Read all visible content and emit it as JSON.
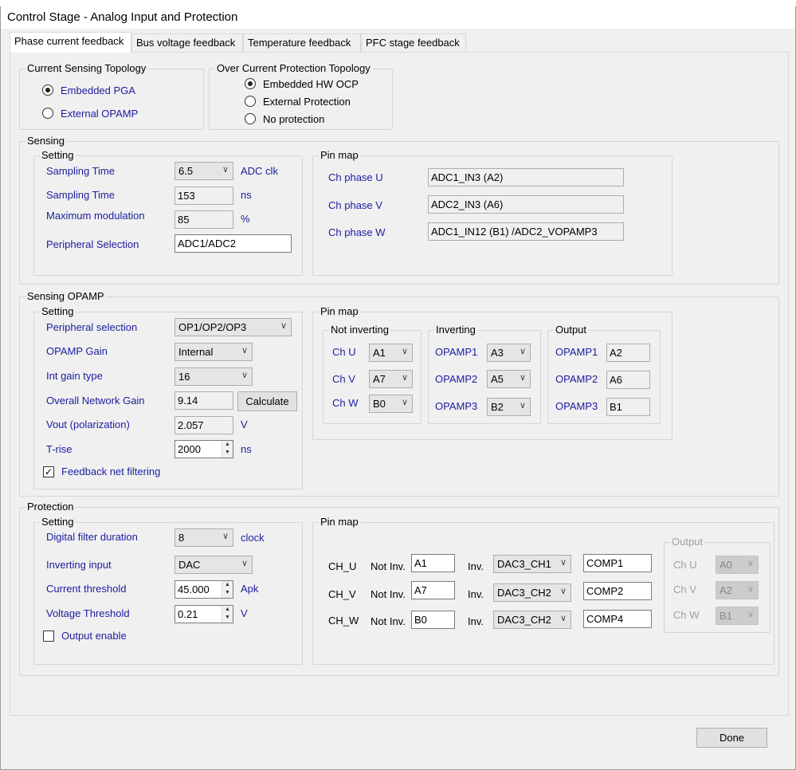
{
  "window": {
    "title": "Control Stage - Analog Input and Protection"
  },
  "tabs": [
    "Phase current feedback",
    "Bus voltage feedback",
    "Temperature feedback",
    "PFC stage feedback"
  ],
  "current_sensing": {
    "title": "Current Sensing Topology",
    "options": [
      "Embedded PGA",
      "External OPAMP"
    ],
    "selected": 0
  },
  "ocp": {
    "title": "Over Current Protection Topology",
    "options": [
      "Embedded HW OCP",
      "External Protection",
      "No protection"
    ],
    "selected": 0
  },
  "sensing": {
    "title": "Sensing",
    "setting_title": "Setting",
    "sampling_time_label": "Sampling Time",
    "sampling_time_value": "6.5",
    "sampling_time_unit": "ADC clk",
    "sampling_ns_label": "Sampling Time",
    "sampling_ns_value": "153",
    "sampling_ns_unit": "ns",
    "max_mod_label": "Maximum modulation",
    "max_mod_value": "85",
    "max_mod_unit": "%",
    "periph_label": "Peripheral Selection",
    "periph_value": "ADC1/ADC2",
    "pinmap_title": "Pin map",
    "pins": [
      {
        "label": "Ch phase U",
        "value": "ADC1_IN3 (A2)"
      },
      {
        "label": "Ch phase V",
        "value": "ADC2_IN3 (A6)"
      },
      {
        "label": "Ch phase W",
        "value": "ADC1_IN12 (B1) /ADC2_VOPAMP3"
      }
    ]
  },
  "opamp": {
    "title": "Sensing OPAMP",
    "setting_title": "Setting",
    "periph_label": "Peripheral selection",
    "periph_value": "OP1/OP2/OP3",
    "gain_label": "OPAMP Gain",
    "gain_value": "Internal",
    "int_gain_label": "Int gain type",
    "int_gain_value": "16",
    "net_gain_label": "Overall Network Gain",
    "net_gain_value": "9.14",
    "calculate": "Calculate",
    "vout_label": "Vout (polarization)",
    "vout_value": "2.057",
    "vout_unit": "V",
    "trise_label": "T-rise",
    "trise_value": "2000",
    "trise_unit": "ns",
    "filter_label": "Feedback net filtering",
    "filter_checked": true,
    "pinmap_title": "Pin map",
    "not_inv": {
      "title": "Not inverting",
      "rows": [
        {
          "label": "Ch U",
          "value": "A1"
        },
        {
          "label": "Ch V",
          "value": "A7"
        },
        {
          "label": "Ch W",
          "value": "B0"
        }
      ]
    },
    "inv": {
      "title": "Inverting",
      "rows": [
        {
          "label": "OPAMP1",
          "value": "A3"
        },
        {
          "label": "OPAMP2",
          "value": "A5"
        },
        {
          "label": "OPAMP3",
          "value": "B2"
        }
      ]
    },
    "out": {
      "title": "Output",
      "rows": [
        {
          "label": "OPAMP1",
          "value": "A2"
        },
        {
          "label": "OPAMP2",
          "value": "A6"
        },
        {
          "label": "OPAMP3",
          "value": "B1"
        }
      ]
    }
  },
  "protection": {
    "title": "Protection",
    "setting_title": "Setting",
    "dfd_label": "Digital filter duration",
    "dfd_value": "8",
    "dfd_unit": "clock",
    "inv_label": "Inverting input",
    "inv_value": "DAC",
    "cur_label": "Current threshold",
    "cur_value": "45.000",
    "cur_unit": "Apk",
    "volt_label": "Voltage Threshold",
    "volt_value": "0.21",
    "volt_unit": "V",
    "out_en_label": "Output enable",
    "out_en_checked": false,
    "pinmap_title": "Pin map",
    "not_inv_label": "Not Inv.",
    "inv_label2": "Inv.",
    "rows": [
      {
        "ch": "CH_U",
        "ni": "A1",
        "inv": "DAC3_CH1",
        "comp": "COMP1"
      },
      {
        "ch": "CH_V",
        "ni": "A7",
        "inv": "DAC3_CH2",
        "comp": "COMP2"
      },
      {
        "ch": "CH_W",
        "ni": "B0",
        "inv": "DAC3_CH2",
        "comp": "COMP4"
      }
    ],
    "output": {
      "title": "Output",
      "rows": [
        {
          "label": "Ch U",
          "value": "A0"
        },
        {
          "label": "Ch V",
          "value": "A2"
        },
        {
          "label": "Ch W",
          "value": "B1"
        }
      ]
    }
  },
  "done": "Done"
}
